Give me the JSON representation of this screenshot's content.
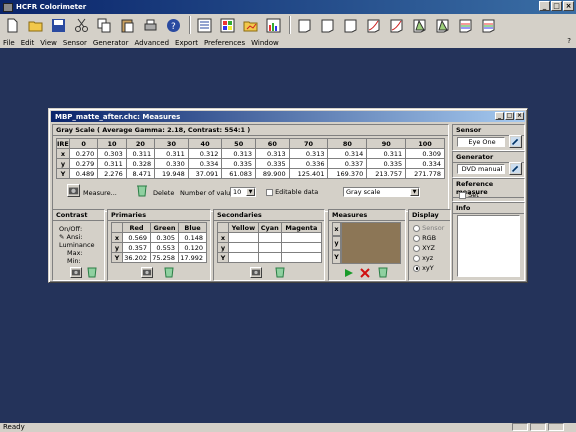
{
  "app": {
    "title": "HCFR Colorimeter"
  },
  "menu": [
    "File",
    "Edit",
    "View",
    "Sensor",
    "Generator",
    "Advanced",
    "Export",
    "Preferences",
    "Window"
  ],
  "menu_right": "?",
  "status": {
    "text": "Ready"
  },
  "toolbar_icons": [
    "new-doc-icon",
    "open-folder-icon",
    "save-icon",
    "cut-icon",
    "copy-icon",
    "paste-icon",
    "print-icon",
    "help-icon",
    "measures-view-icon",
    "color-chart-icon",
    "folder-chart-icon",
    "bars-chart-icon",
    "blank-view-icon",
    "blank-view-icon",
    "blank-view-icon",
    "gamma-curve-icon",
    "gamma-curve-icon",
    "cie-diagram-icon",
    "cie-diagram-icon",
    "rgb-levels-icon",
    "rgb-levels-icon"
  ],
  "child": {
    "title": "MBP_matte_after.chc: Measures",
    "grayscale": {
      "header": "Gray Scale ( Average Gamma: 2.18, Contrast: 554:1 )",
      "columns": [
        "IRE",
        "0",
        "10",
        "20",
        "30",
        "40",
        "50",
        "60",
        "70",
        "80",
        "90",
        "100"
      ],
      "rows": [
        {
          "label": "x",
          "values": [
            "0.270",
            "0.303",
            "0.311",
            "0.311",
            "0.312",
            "0.313",
            "0.313",
            "0.313",
            "0.314",
            "0.311",
            "0.309"
          ]
        },
        {
          "label": "y",
          "values": [
            "0.279",
            "0.311",
            "0.328",
            "0.330",
            "0.334",
            "0.335",
            "0.335",
            "0.336",
            "0.337",
            "0.335",
            "0.334"
          ]
        },
        {
          "label": "Y",
          "values": [
            "0.489",
            "2.276",
            "8.471",
            "19.948",
            "37.091",
            "61.083",
            "89.900",
            "125.401",
            "169.370",
            "213.757",
            "271.778"
          ]
        }
      ],
      "measure_label": "Measure...",
      "delete_label": "Delete",
      "num_values_label": "Number of values",
      "num_values": "10",
      "editable_label": "Editable data",
      "scale_select": "Gray scale"
    },
    "contrast": {
      "header": "Contrast",
      "onoff": "On/Off:",
      "ansi": "Ansi:",
      "luminance": "Luminance",
      "max": "Max:",
      "min": "Min:"
    },
    "primaries": {
      "header": "Primaries",
      "columns": [
        "Red",
        "Green",
        "Blue"
      ],
      "rows": [
        {
          "label": "x",
          "values": [
            "0.569",
            "0.305",
            "0.148"
          ]
        },
        {
          "label": "y",
          "values": [
            "0.357",
            "0.553",
            "0.120"
          ]
        },
        {
          "label": "Y",
          "values": [
            "36.202",
            "75.258",
            "17.992"
          ]
        }
      ]
    },
    "secondaries": {
      "header": "Secondaries",
      "columns": [
        "Yellow",
        "Cyan",
        "Magenta"
      ]
    },
    "measures": {
      "header": "Measures",
      "rows": [
        "x",
        "y",
        "Y"
      ]
    },
    "display": {
      "header": "Display",
      "options": [
        "Sensor",
        "RGB",
        "XYZ",
        "xyz",
        "xyY"
      ],
      "selected": "xyY"
    },
    "sensor": {
      "header": "Sensor",
      "value": "Eye One"
    },
    "generator": {
      "header": "Generator",
      "value": "DVD manual"
    },
    "reference": {
      "header": "Reference measure",
      "set_label": "Set"
    },
    "info": {
      "header": "Info"
    }
  }
}
